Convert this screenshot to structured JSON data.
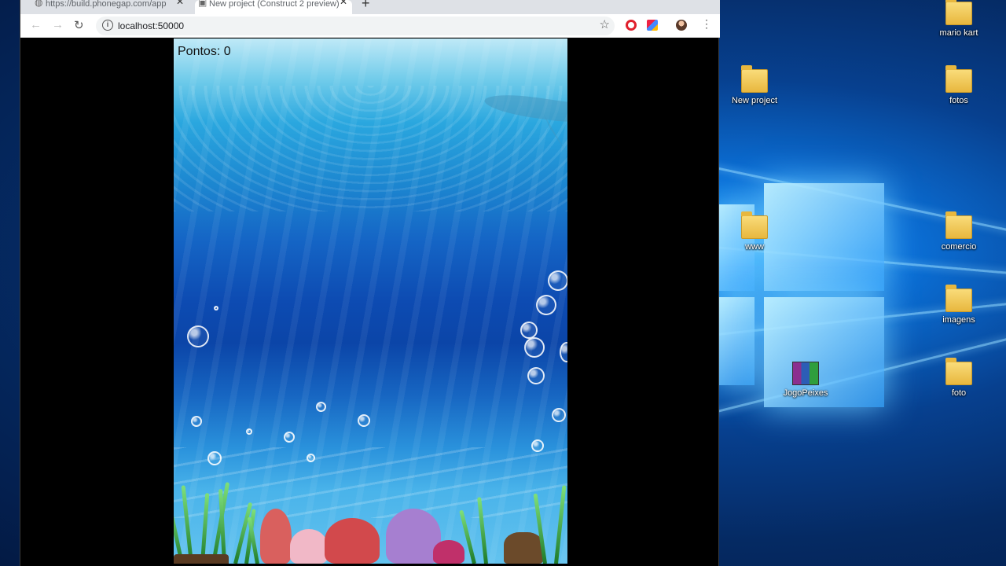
{
  "browser": {
    "tabs": [
      {
        "label": "https://build.phonegap.com/app",
        "active": false
      },
      {
        "label": "New project (Construct 2 preview)",
        "active": true
      }
    ],
    "url": "localhost:50000"
  },
  "game": {
    "score_label": "Pontos: 0"
  },
  "desktop": {
    "icons": [
      {
        "label": "mario kart",
        "type": "folder"
      },
      {
        "label": "New project",
        "type": "folder"
      },
      {
        "label": "fotos",
        "type": "folder"
      },
      {
        "label": "www",
        "type": "folder"
      },
      {
        "label": "comercio",
        "type": "folder"
      },
      {
        "label": "imagens",
        "type": "folder"
      },
      {
        "label": "JogoPeixes",
        "type": "rar-archive"
      },
      {
        "label": "foto",
        "type": "folder"
      }
    ]
  },
  "colors": {
    "opera_red": "#e0202c",
    "desktop_blue": "#0b6fd6"
  }
}
